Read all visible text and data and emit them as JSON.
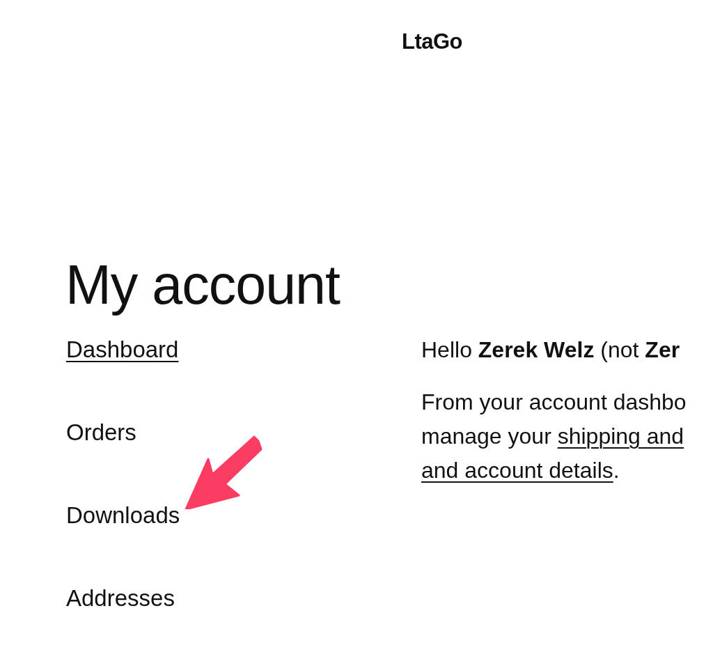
{
  "site": {
    "logo": "LtaGo"
  },
  "page": {
    "title": "My account"
  },
  "nav": {
    "items": [
      {
        "label": "Dashboard",
        "selected": true
      },
      {
        "label": "Orders",
        "selected": false
      },
      {
        "label": "Downloads",
        "selected": false
      },
      {
        "label": "Addresses",
        "selected": false
      }
    ]
  },
  "content": {
    "greeting": "Hello **Zerek Welz** (not **Zer**",
    "paragraph_lines": [
      [
        {
          "text": "From your account dashbo",
          "link": false
        }
      ],
      [
        {
          "text": "manage your ",
          "link": false
        },
        {
          "text": "shipping and",
          "link": true
        }
      ],
      [
        {
          "text": "and account details",
          "link": true
        },
        {
          "text": ".",
          "link": false
        }
      ]
    ]
  }
}
